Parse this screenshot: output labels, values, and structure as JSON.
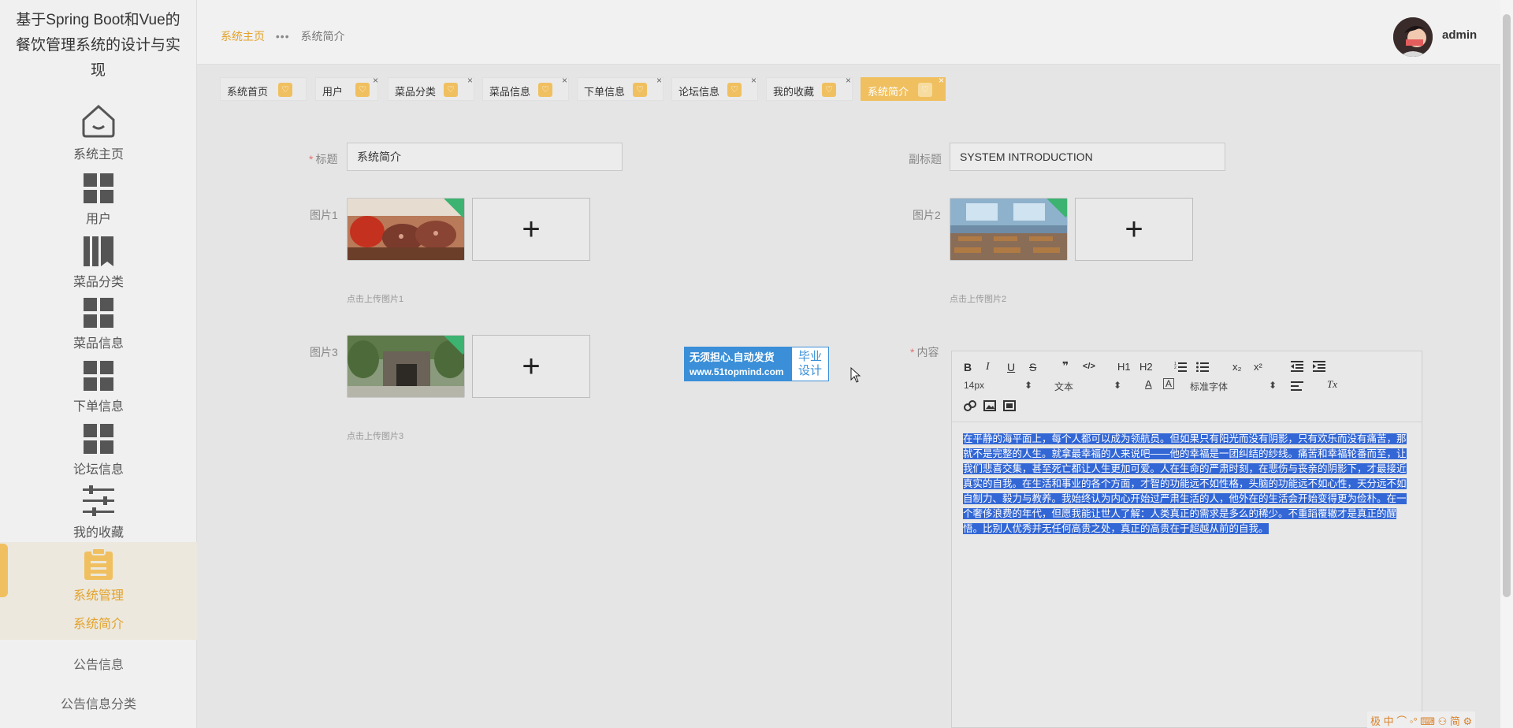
{
  "app": {
    "title": "基于Spring Boot和Vue的餐饮管理系统的设计与实现"
  },
  "sidebar": {
    "items": [
      {
        "label": "系统主页",
        "icon": "home-icon"
      },
      {
        "label": "用户",
        "icon": "grid-icon"
      },
      {
        "label": "菜品分类",
        "icon": "book-icon"
      },
      {
        "label": "菜品信息",
        "icon": "grid-icon"
      },
      {
        "label": "下单信息",
        "icon": "grid-icon"
      },
      {
        "label": "论坛信息",
        "icon": "grid-icon"
      },
      {
        "label": "我的收藏",
        "icon": "sliders-icon"
      },
      {
        "label": "系统管理",
        "icon": "clipboard-icon"
      }
    ],
    "sub_items": [
      "系统简介",
      "公告信息",
      "公告信息分类"
    ]
  },
  "header": {
    "breadcrumb_home": "系统主页",
    "breadcrumb_sep": "•••",
    "breadcrumb_current": "系统简介",
    "username": "admin"
  },
  "tabs": [
    {
      "label": "系统首页",
      "closable": false
    },
    {
      "label": "用户",
      "closable": true
    },
    {
      "label": "菜品分类",
      "closable": true
    },
    {
      "label": "菜品信息",
      "closable": true
    },
    {
      "label": "下单信息",
      "closable": true
    },
    {
      "label": "论坛信息",
      "closable": true
    },
    {
      "label": "我的收藏",
      "closable": true
    },
    {
      "label": "系统简介",
      "closable": true,
      "active": true
    }
  ],
  "tab_close_symbol": "×",
  "form": {
    "title_label": "标题",
    "title_value": "系统简介",
    "subtitle_label": "副标题",
    "subtitle_value": "SYSTEM INTRODUCTION",
    "pic1_label": "图片1",
    "pic1_hint": "点击上传图片1",
    "pic2_label": "图片2",
    "pic2_hint": "点击上传图片2",
    "pic3_label": "图片3",
    "pic3_hint": "点击上传图片3",
    "content_label": "内容",
    "required_mark": "*",
    "upload_plus": "+"
  },
  "watermark": {
    "line1": "无须担心.自动发货",
    "line2": "www.51topmind.com",
    "right1": "毕业",
    "right2": "设计"
  },
  "editor": {
    "toolbar": {
      "bold": "B",
      "italic": "I",
      "underline": "U",
      "strike": "S",
      "quote": "❞",
      "code": "</>",
      "h1": "H1",
      "h2": "H2",
      "sub": "x₂",
      "sup": "x²",
      "size": "14px",
      "style": "文本",
      "font": "标准字体",
      "clear": "Tx"
    },
    "content": "在平静的海平面上，每个人都可以成为领航员。但如果只有阳光而没有阴影，只有欢乐而没有痛苦，那就不是完整的人生。就拿最幸福的人来说吧——他的幸福是一团纠结的纱线。痛苦和幸福轮番而至，让我们悲喜交集，甚至死亡都让人生更加可爱。人在生命的严肃时刻，在悲伤与丧亲的阴影下，才最接近真实的自我。在生活和事业的各个方面，才智的功能远不如性格，头脑的功能远不如心性，天分远不如自制力、毅力与教养。我始终认为内心开始过严肃生活的人，他外在的生活会开始变得更为俭朴。在一个奢侈浪费的年代，但愿我能让世人了解：人类真正的需求是多么的稀少。不重蹈覆辙才是真正的醒悟。比别人优秀并无任何高贵之处，真正的高贵在于超越从前的自我。"
  },
  "ime": {
    "text": "极 中 ⌒ ◦° ⌨ ⚇ 简 ⚙"
  },
  "colors": {
    "accent": "#f0c060",
    "accent_text": "#e3a22b",
    "selection": "#3367d6",
    "watermark_blue": "#3a8fd8"
  }
}
